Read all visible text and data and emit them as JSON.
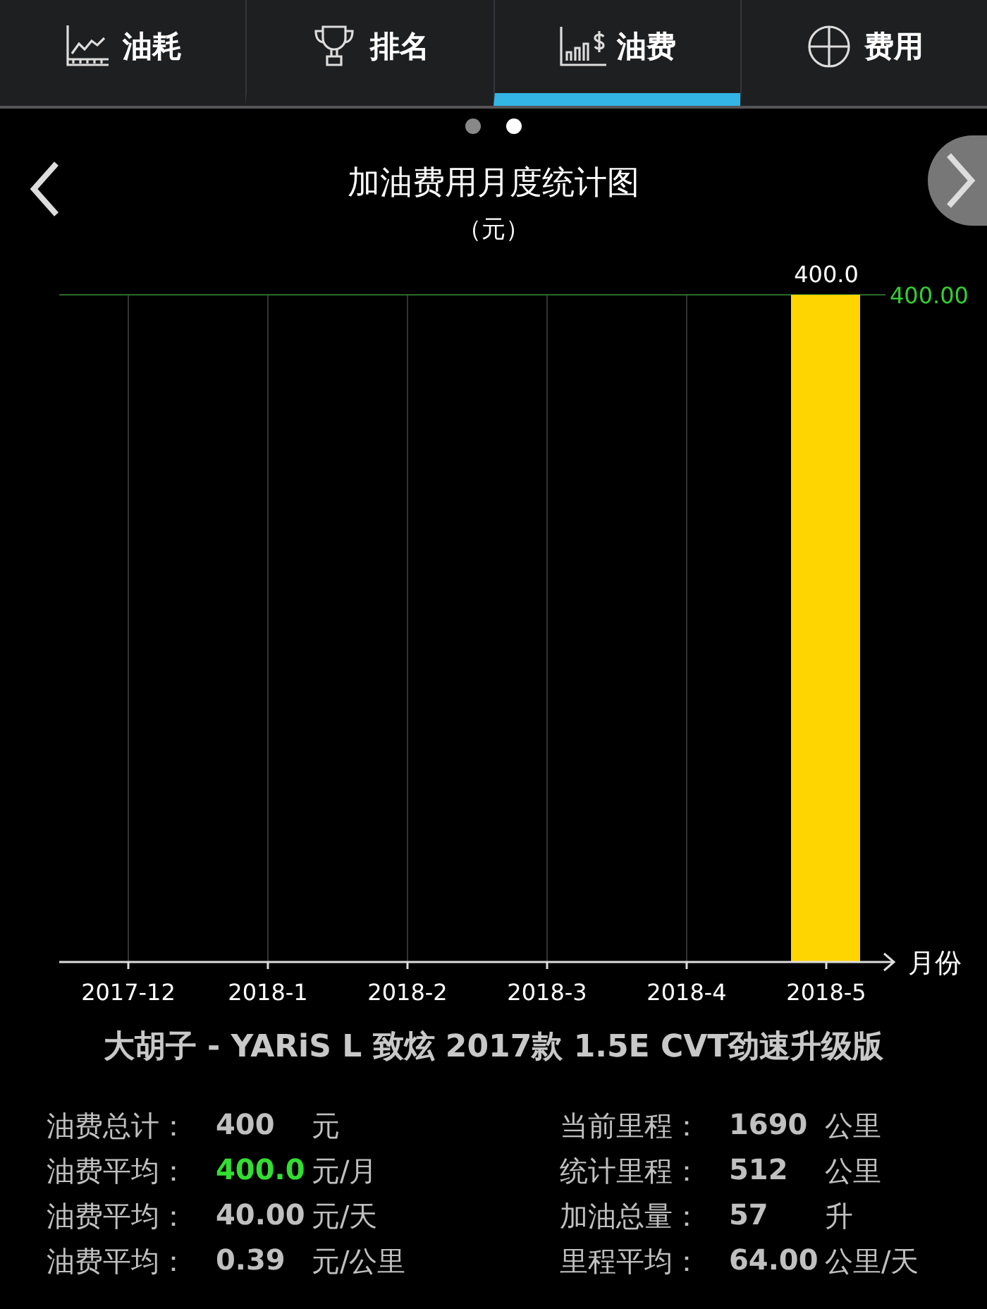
{
  "tabs": [
    {
      "label": "油耗",
      "selected": false
    },
    {
      "label": "排名",
      "selected": false
    },
    {
      "label": "油费",
      "selected": true
    },
    {
      "label": "费用",
      "selected": false
    }
  ],
  "pager": [
    {
      "selected": false
    },
    {
      "selected": true
    }
  ],
  "chart": {
    "title": "加油费用月度统计图",
    "unit": "（元）",
    "chart_data": {
      "type": "bar",
      "categories": [
        "2017-12",
        "2018-1",
        "2018-2",
        "2018-3",
        "2018-4",
        "2018-5"
      ],
      "series": [
        {
          "color": "#ffd500",
          "values": [
            null,
            null,
            null,
            null,
            null,
            400
          ],
          "value_labels": [
            null,
            null,
            null,
            null,
            null,
            "400.0"
          ]
        }
      ],
      "xlabel": "月份",
      "data_labels": true,
      "grid": true
    },
    "max_line_label": "400.00"
  },
  "car_title": "大胡子 - YARiS L 致炫 2017款 1.5E CVT劲速升级版",
  "stats": [
    [
      {
        "label": "油费总计：",
        "value": "400",
        "unit": "元",
        "highlight": false
      },
      {
        "label": "油费平均：",
        "value": "400.0",
        "unit": "元/月",
        "highlight": true
      },
      {
        "label": "油费平均：",
        "value": "40.00",
        "unit": "元/天",
        "highlight": false
      },
      {
        "label": "油费平均：",
        "value": "0.39",
        "unit": "元/公里",
        "highlight": false
      }
    ],
    [
      {
        "label": "当前里程：",
        "value": "1690",
        "unit": "公里",
        "highlight": false
      },
      {
        "label": "统计里程：",
        "value": "512",
        "unit": "公里",
        "highlight": false
      },
      {
        "label": "加油总量：",
        "value": "57",
        "unit": "升",
        "highlight": false
      },
      {
        "label": "里程平均：",
        "value": "64.00",
        "unit": "公里/天",
        "highlight": false
      }
    ]
  ]
}
